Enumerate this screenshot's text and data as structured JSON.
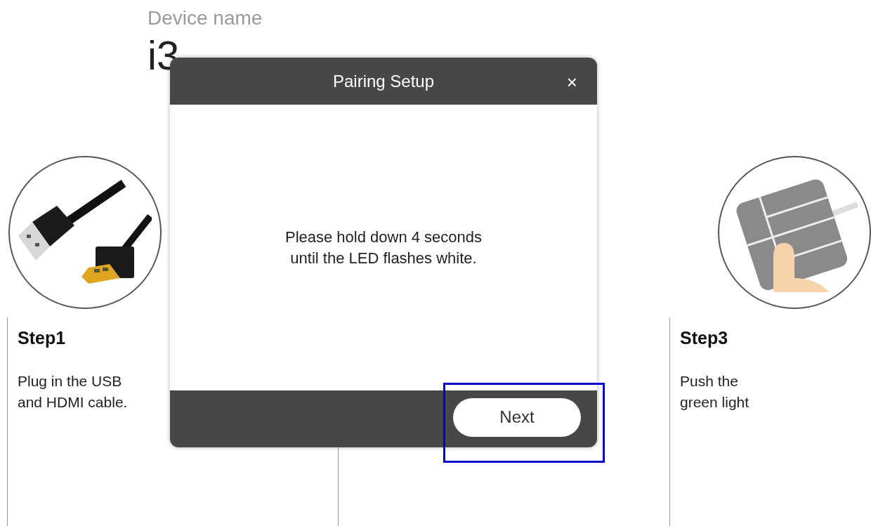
{
  "device": {
    "label": "Device name",
    "name": "i3"
  },
  "steps": [
    {
      "kind": "cables",
      "title": "Step1",
      "text": "Plug in the USB\nand HDMI cable."
    },
    {
      "kind": "hidden"
    },
    {
      "kind": "button-press",
      "title": "Step3",
      "text": "Push the\ngreen light"
    }
  ],
  "dialog": {
    "title": "Pairing Setup",
    "close": "×",
    "message": "Please hold down 4 seconds\n until the LED flashes white.",
    "button": {
      "label": "Next",
      "highlighted": true
    }
  }
}
